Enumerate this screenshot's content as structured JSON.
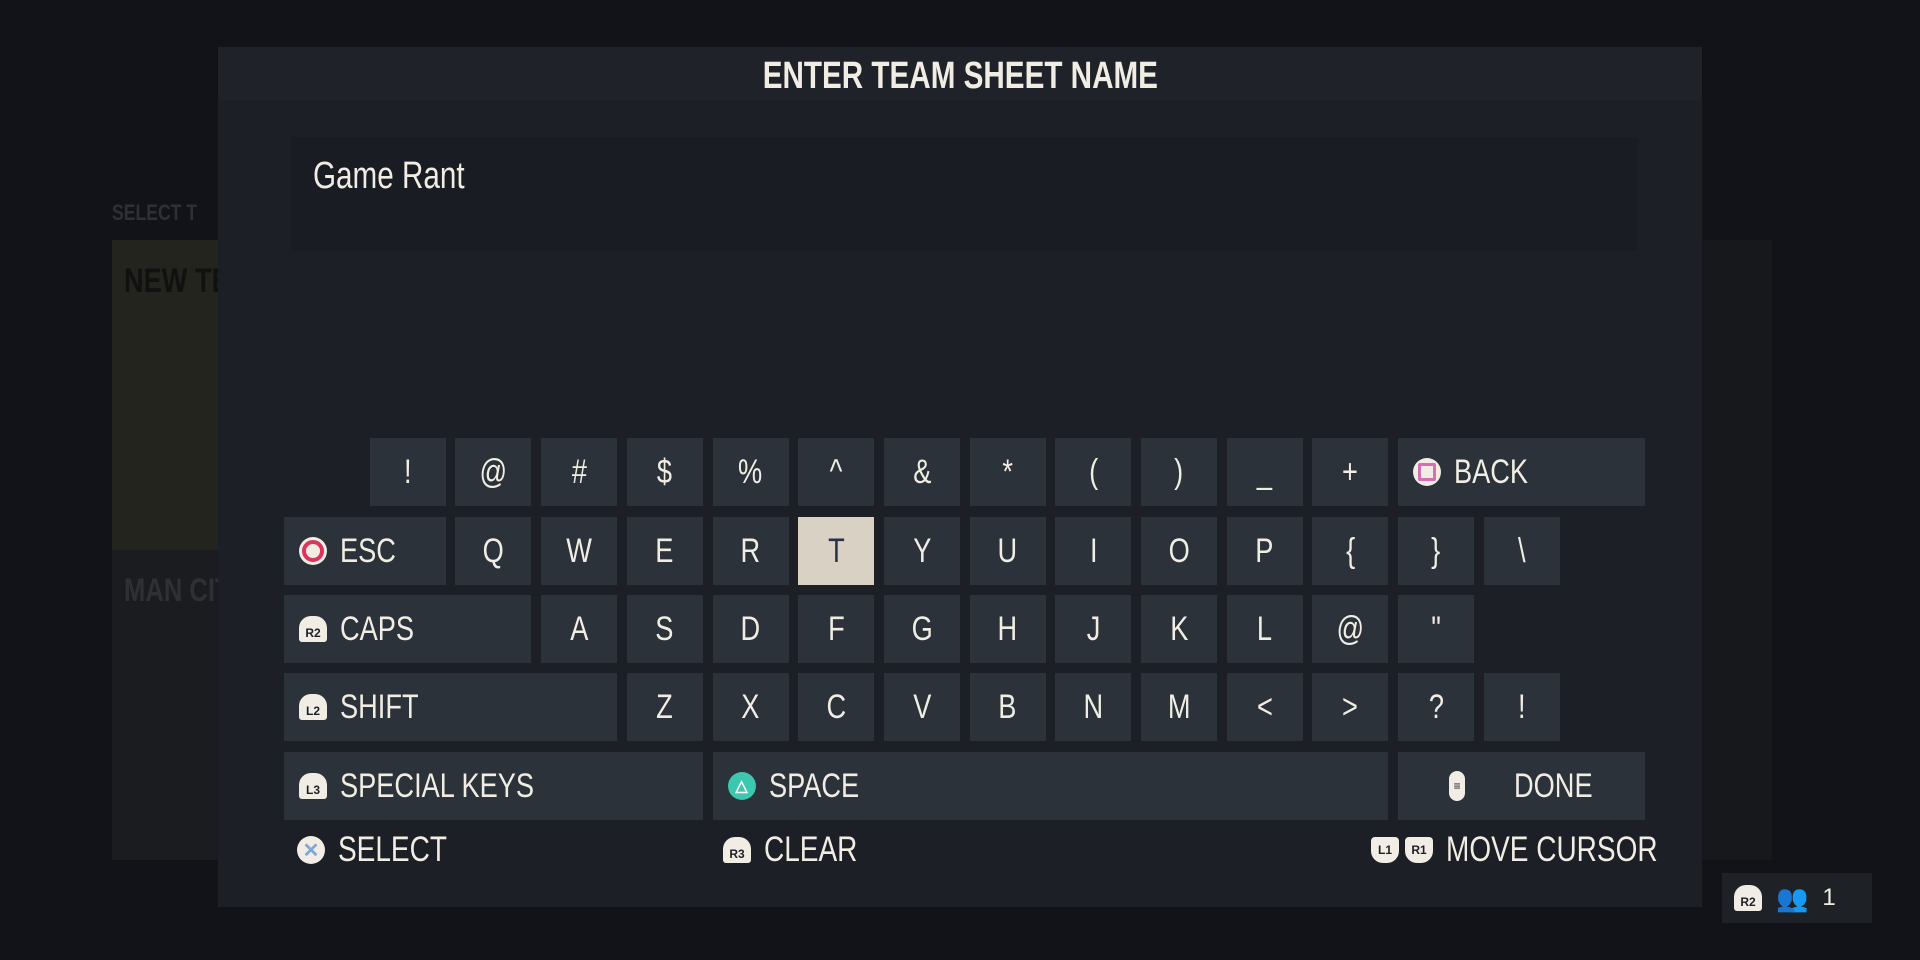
{
  "background": {
    "select_label": "SELECT T",
    "new_team_label": "NEW TE",
    "team_label": "MAN CIT"
  },
  "dialog": {
    "title": "ENTER TEAM SHEET NAME",
    "input_value": "Game Rant"
  },
  "keyboard": {
    "selected_key": "T",
    "rows": [
      [
        {
          "label": "!",
          "col": 1,
          "span": 1
        },
        {
          "label": "@",
          "col": 2,
          "span": 1
        },
        {
          "label": "#",
          "col": 3,
          "span": 1
        },
        {
          "label": "$",
          "col": 4,
          "span": 1
        },
        {
          "label": "%",
          "col": 5,
          "span": 1
        },
        {
          "label": "^",
          "col": 6,
          "span": 1
        },
        {
          "label": "&",
          "col": 7,
          "span": 1
        },
        {
          "label": "*",
          "col": 8,
          "span": 1
        },
        {
          "label": "(",
          "col": 9,
          "span": 1
        },
        {
          "label": ")",
          "col": 10,
          "span": 1
        },
        {
          "label": "_",
          "col": 11,
          "span": 1
        },
        {
          "label": "+",
          "col": 12,
          "span": 1
        },
        {
          "label": "BACK",
          "col": 13,
          "span": 3,
          "icon": "square-button-icon"
        }
      ],
      [
        {
          "label": "ESC",
          "col": 0,
          "span": 2,
          "icon": "circle-button-icon"
        },
        {
          "label": "Q",
          "col": 2,
          "span": 1
        },
        {
          "label": "W",
          "col": 3,
          "span": 1
        },
        {
          "label": "E",
          "col": 4,
          "span": 1
        },
        {
          "label": "R",
          "col": 5,
          "span": 1
        },
        {
          "label": "T",
          "col": 6,
          "span": 1
        },
        {
          "label": "Y",
          "col": 7,
          "span": 1
        },
        {
          "label": "U",
          "col": 8,
          "span": 1
        },
        {
          "label": "I",
          "col": 9,
          "span": 1
        },
        {
          "label": "O",
          "col": 10,
          "span": 1
        },
        {
          "label": "P",
          "col": 11,
          "span": 1
        },
        {
          "label": "{",
          "col": 12,
          "span": 1
        },
        {
          "label": "}",
          "col": 13,
          "span": 1
        },
        {
          "label": "\\",
          "col": 14,
          "span": 1
        }
      ],
      [
        {
          "label": "CAPS",
          "col": 0,
          "span": 3,
          "icon": "r2-button-icon",
          "icon_text": "R2"
        },
        {
          "label": "A",
          "col": 3,
          "span": 1
        },
        {
          "label": "S",
          "col": 4,
          "span": 1
        },
        {
          "label": "D",
          "col": 5,
          "span": 1
        },
        {
          "label": "F",
          "col": 6,
          "span": 1
        },
        {
          "label": "G",
          "col": 7,
          "span": 1
        },
        {
          "label": "H",
          "col": 8,
          "span": 1
        },
        {
          "label": "J",
          "col": 9,
          "span": 1
        },
        {
          "label": "K",
          "col": 10,
          "span": 1
        },
        {
          "label": "L",
          "col": 11,
          "span": 1
        },
        {
          "label": "@",
          "col": 12,
          "span": 1
        },
        {
          "label": "\"",
          "col": 13,
          "span": 1
        }
      ],
      [
        {
          "label": "SHIFT",
          "col": 0,
          "span": 4,
          "icon": "l2-button-icon",
          "icon_text": "L2"
        },
        {
          "label": "Z",
          "col": 4,
          "span": 1
        },
        {
          "label": "X",
          "col": 5,
          "span": 1
        },
        {
          "label": "C",
          "col": 6,
          "span": 1
        },
        {
          "label": "V",
          "col": 7,
          "span": 1
        },
        {
          "label": "B",
          "col": 8,
          "span": 1
        },
        {
          "label": "N",
          "col": 9,
          "span": 1
        },
        {
          "label": "M",
          "col": 10,
          "span": 1
        },
        {
          "label": "<",
          "col": 11,
          "span": 1
        },
        {
          "label": ">",
          "col": 12,
          "span": 1
        },
        {
          "label": "?",
          "col": 13,
          "span": 1
        },
        {
          "label": "!",
          "col": 14,
          "span": 1
        }
      ],
      [
        {
          "label": "SPECIAL KEYS",
          "col": 0,
          "span": 5,
          "icon": "l3-button-icon",
          "icon_text": "L3"
        },
        {
          "label": "SPACE",
          "col": 5,
          "span": 8,
          "icon": "triangle-button-icon"
        },
        {
          "label": "DONE",
          "col": 13,
          "span": 3,
          "icon": "options-button-icon"
        }
      ]
    ]
  },
  "footer": {
    "select": {
      "label": "SELECT",
      "icon": "cross-button-icon"
    },
    "clear": {
      "label": "CLEAR",
      "icon": "r3-button-icon",
      "icon_text": "R3"
    },
    "move_cursor": {
      "label": "MOVE CURSOR",
      "icon_left": "L1",
      "icon_right": "R1"
    }
  },
  "players_widget": {
    "button": "R2",
    "count": "1"
  },
  "colors": {
    "circle": "#d9365e",
    "square": "#d66fb0",
    "triangle": "#3ec7b0",
    "cross": "#7fa6d6",
    "key_bg": "#2b3239",
    "selected_key_bg": "#d8d1c4"
  }
}
